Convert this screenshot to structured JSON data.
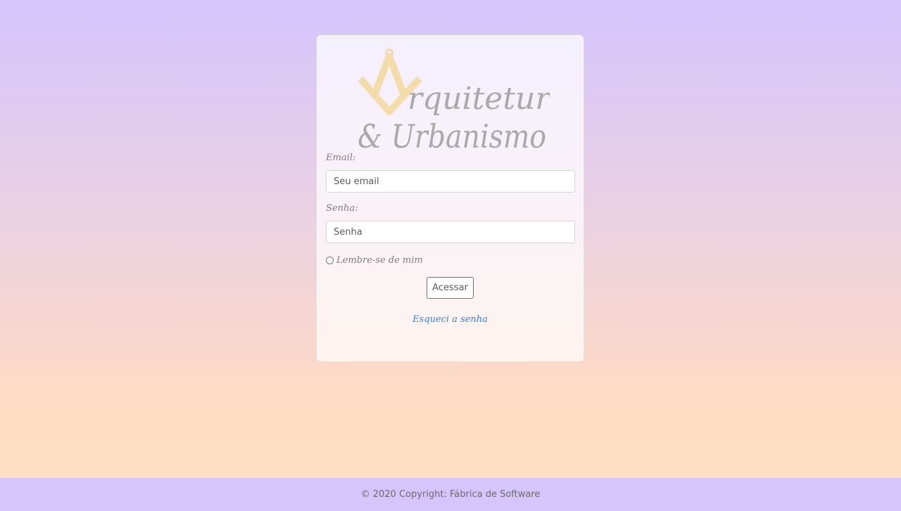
{
  "logo": {
    "line1": "rquitetura",
    "line2": "& Urbanismo",
    "icon": "compass-square-icon",
    "icon_color": "#f4dcaa",
    "text_color": "#a9a9a9"
  },
  "form": {
    "email_label": "Email:",
    "email_placeholder": "Seu email",
    "password_label": "Senha:",
    "password_placeholder": "Senha",
    "remember_label": "Lembre-se de mim",
    "submit_label": "Acessar",
    "forgot_label": "Esqueci a senha"
  },
  "footer": {
    "text": "© 2020 Copyright: Fábrica de Software"
  },
  "colors": {
    "footer_bg": "#d4c5fc",
    "link": "#3a7bd5"
  }
}
